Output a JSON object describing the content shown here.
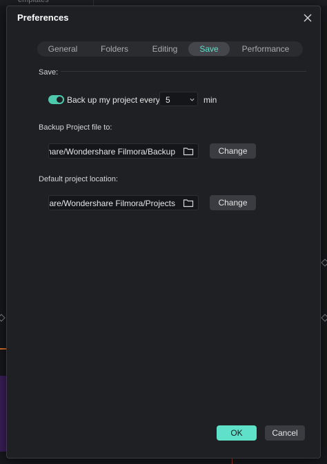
{
  "background": {
    "partial_tab_label": "emplates"
  },
  "dialog": {
    "title": "Preferences",
    "tabs": [
      {
        "label": "General",
        "active": false
      },
      {
        "label": "Folders",
        "active": false
      },
      {
        "label": "Editing",
        "active": false
      },
      {
        "label": "Save",
        "active": true
      },
      {
        "label": "Performance",
        "active": false
      }
    ],
    "save_section": {
      "label": "Save:",
      "autosave_enabled": true,
      "autosave_label": "Back up my project every",
      "interval_value": "5",
      "interval_unit": "min"
    },
    "backup_location": {
      "label": "Backup Project file to:",
      "path": "hare/Wondershare Filmora/Backup",
      "change_label": "Change"
    },
    "default_location": {
      "label": "Default project location:",
      "path": "hare/Wondershare Filmora/Projects",
      "change_label": "Change"
    },
    "footer": {
      "ok_label": "OK",
      "cancel_label": "Cancel"
    }
  },
  "colors": {
    "accent": "#5fe0c8",
    "dialog_bg": "#1f2023",
    "field_bg": "#15161a",
    "button_bg": "#3a3c42"
  },
  "icons": {
    "close": "close-icon",
    "dropdown": "chevron-down-icon",
    "folder": "folder-icon"
  }
}
